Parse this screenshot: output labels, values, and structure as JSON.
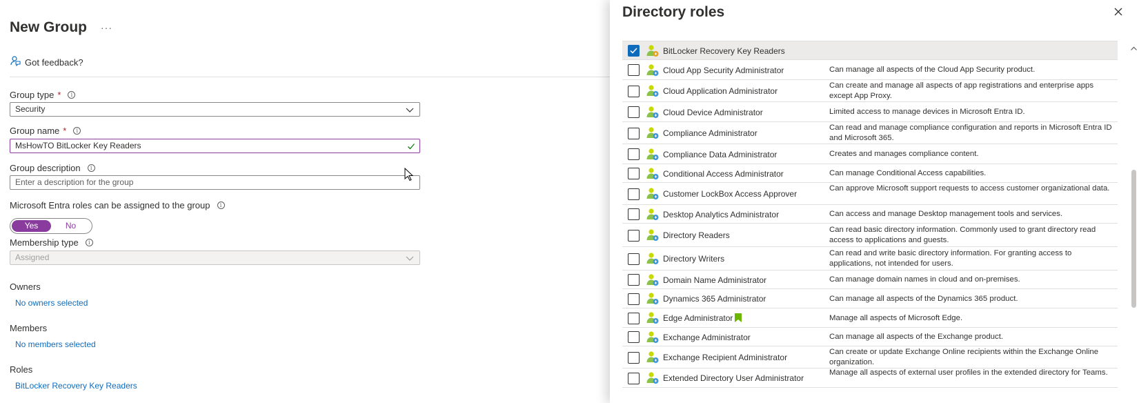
{
  "left": {
    "title": "New Group",
    "more": "···",
    "feedback": "Got feedback?",
    "group_type": {
      "label": "Group type",
      "required": "*",
      "value": "Security"
    },
    "group_name": {
      "label": "Group name",
      "required": "*",
      "value": "MsHowTO BitLocker Key Readers"
    },
    "group_description": {
      "label": "Group description",
      "placeholder": "Enter a description for the group"
    },
    "entra_roles": {
      "label": "Microsoft Entra roles can be assigned to the group",
      "yes": "Yes",
      "no": "No",
      "selected": "Yes"
    },
    "membership_type": {
      "label": "Membership type",
      "value": "Assigned"
    },
    "owners": {
      "label": "Owners",
      "link": "No owners selected"
    },
    "members": {
      "label": "Members",
      "link": "No members selected"
    },
    "roles": {
      "label": "Roles",
      "link": "BitLocker Recovery Key Readers"
    }
  },
  "panel": {
    "title": "Directory roles",
    "roles": [
      {
        "name": "BitLocker Recovery Key Readers",
        "desc": "",
        "checked": true
      },
      {
        "name": "Cloud App Security Administrator",
        "desc": "Can manage all aspects of the Cloud App Security product.",
        "checked": false
      },
      {
        "name": "Cloud Application Administrator",
        "desc": "Can create and manage all aspects of app registrations and enterprise apps except App Proxy.",
        "checked": false
      },
      {
        "name": "Cloud Device Administrator",
        "desc": "Limited access to manage devices in Microsoft Entra ID.",
        "checked": false
      },
      {
        "name": "Compliance Administrator",
        "desc": "Can read and manage compliance configuration and reports in Microsoft Entra ID and Microsoft 365.",
        "checked": false
      },
      {
        "name": "Compliance Data Administrator",
        "desc": "Creates and manages compliance content.",
        "checked": false
      },
      {
        "name": "Conditional Access Administrator",
        "desc": "Can manage Conditional Access capabilities.",
        "checked": false
      },
      {
        "name": "Customer LockBox Access Approver",
        "desc": "Can approve Microsoft support requests to access customer organizational data.",
        "checked": false
      },
      {
        "name": "Desktop Analytics Administrator",
        "desc": "Can access and manage Desktop management tools and services.",
        "checked": false
      },
      {
        "name": "Directory Readers",
        "desc": "Can read basic directory information. Commonly used to grant directory read access to applications and guests.",
        "checked": false
      },
      {
        "name": "Directory Writers",
        "desc": "Can read and write basic directory information. For granting access to applications, not intended for users.",
        "checked": false
      },
      {
        "name": "Domain Name Administrator",
        "desc": "Can manage domain names in cloud and on-premises.",
        "checked": false
      },
      {
        "name": "Dynamics 365 Administrator",
        "desc": "Can manage all aspects of the Dynamics 365 product.",
        "checked": false
      },
      {
        "name": "Edge Administrator",
        "desc": "Manage all aspects of Microsoft Edge.",
        "checked": false,
        "badge": "bookmark-icon"
      },
      {
        "name": "Exchange Administrator",
        "desc": "Can manage all aspects of the Exchange product.",
        "checked": false
      },
      {
        "name": "Exchange Recipient Administrator",
        "desc": "Can create or update Exchange Online recipients within the Exchange Online organization.",
        "checked": false
      },
      {
        "name": "Extended Directory User Administrator",
        "desc": "Manage all aspects of external user profiles in the extended directory for Teams.",
        "checked": false
      }
    ]
  },
  "colors": {
    "accent": "#8a3c9e",
    "link": "#0f6cbd",
    "checkbox": "#0f6cbd",
    "valid": "#107c10",
    "badge": "#6bb700"
  }
}
